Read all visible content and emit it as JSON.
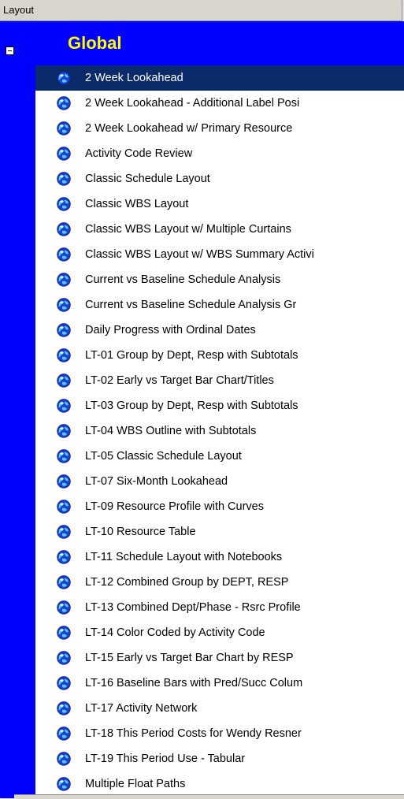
{
  "header": {
    "title": "Layout"
  },
  "group": {
    "title": "Global"
  },
  "colors": {
    "group_band": "#0000ff",
    "group_title": "#ffff00",
    "selection": "#0a2a6a"
  },
  "items": [
    {
      "label": "2 Week Lookahead",
      "selected": true
    },
    {
      "label": "2 Week Lookahead - Additional Label Posi"
    },
    {
      "label": "2 Week Lookahead w/ Primary Resource"
    },
    {
      "label": "Activity Code Review"
    },
    {
      "label": "Classic Schedule Layout"
    },
    {
      "label": "Classic WBS Layout"
    },
    {
      "label": "Classic WBS Layout w/ Multiple Curtains"
    },
    {
      "label": "Classic WBS Layout w/ WBS Summary Activi"
    },
    {
      "label": "Current vs Baseline Schedule Analysis"
    },
    {
      "label": "Current vs Baseline Schedule Analysis Gr"
    },
    {
      "label": "Daily Progress with Ordinal Dates"
    },
    {
      "label": "LT-01 Group by Dept, Resp with Subtotals"
    },
    {
      "label": "LT-02 Early vs Target Bar Chart/Titles"
    },
    {
      "label": "LT-03 Group by Dept, Resp with Subtotals"
    },
    {
      "label": "LT-04 WBS Outline with Subtotals"
    },
    {
      "label": "LT-05 Classic Schedule Layout"
    },
    {
      "label": "LT-07 Six-Month Lookahead"
    },
    {
      "label": "LT-09 Resource Profile with Curves"
    },
    {
      "label": "LT-10 Resource Table"
    },
    {
      "label": "LT-11 Schedule Layout with Notebooks"
    },
    {
      "label": "LT-12 Combined Group by DEPT, RESP"
    },
    {
      "label": "LT-13 Combined Dept/Phase - Rsrc Profile"
    },
    {
      "label": "LT-14 Color Coded by Activity Code"
    },
    {
      "label": "LT-15 Early vs Target Bar Chart by RESP"
    },
    {
      "label": "LT-16 Baseline Bars with Pred/Succ Colum"
    },
    {
      "label": "LT-17 Activity Network"
    },
    {
      "label": "LT-18 This Period Costs for Wendy Resner"
    },
    {
      "label": "LT-19 This Period Use - Tabular"
    },
    {
      "label": "Multiple Float Paths"
    }
  ]
}
